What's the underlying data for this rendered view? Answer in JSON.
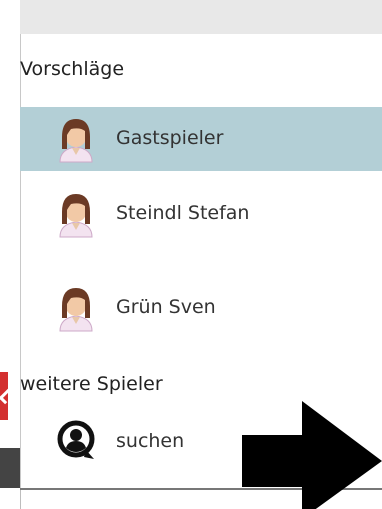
{
  "dropdown": {
    "suggestions_header": "Vorschläge",
    "suggestions": [
      {
        "label": "Gastspieler",
        "selected": true,
        "icon": "female-player-avatar-icon"
      },
      {
        "label": "Steindl Stefan",
        "selected": false,
        "icon": "female-player-avatar-icon"
      },
      {
        "label": "Grün Sven",
        "selected": false,
        "icon": "female-player-avatar-icon"
      }
    ],
    "more_header": "weitere Spieler",
    "search_label": "suchen",
    "search_icon": "search-person-icon"
  },
  "colors": {
    "selected_row": "#b3cfd6",
    "accent_red": "#d32f2f",
    "arrow": "#000000"
  }
}
